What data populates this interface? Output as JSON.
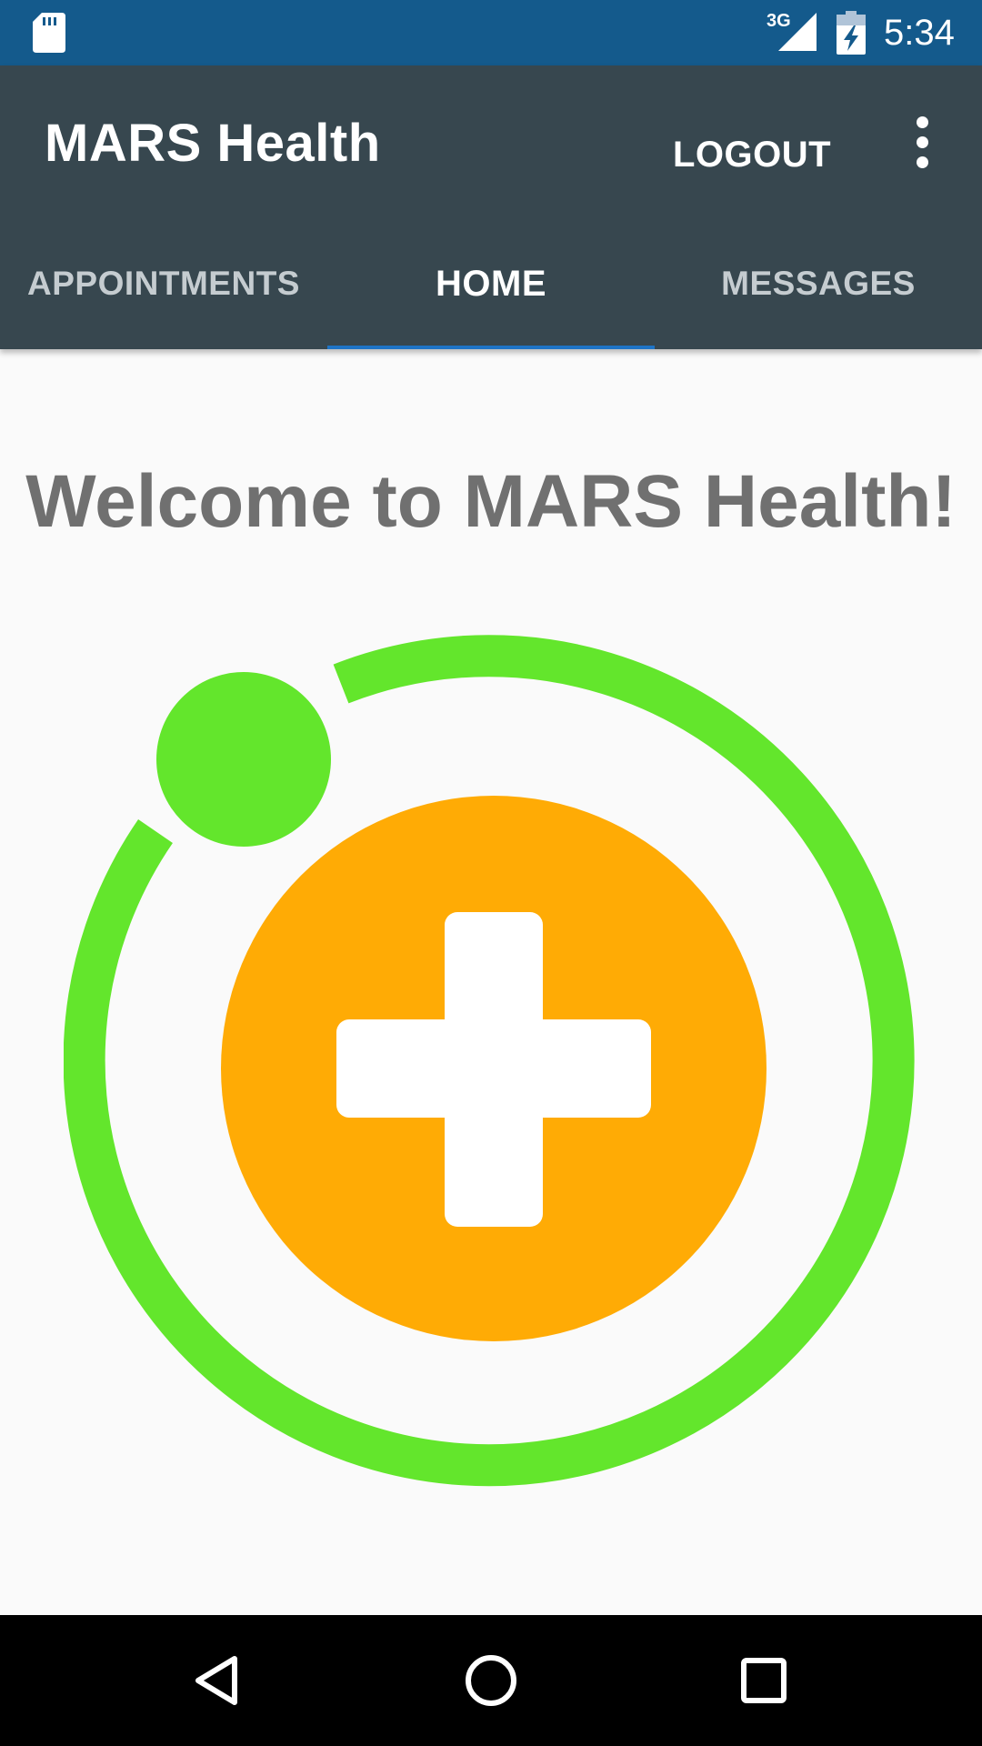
{
  "status_bar": {
    "network": "3G",
    "time": "5:34",
    "icons": [
      "sd-card-icon",
      "signal-icon",
      "battery-charging-icon"
    ],
    "color": "#145a8c"
  },
  "app_bar": {
    "title": "MARS Health",
    "logout_label": "LOGOUT",
    "overflow_icon": "more-vert-icon",
    "color": "#37474f"
  },
  "tabs": [
    {
      "label": "APPOINTMENTS",
      "active": false
    },
    {
      "label": "HOME",
      "active": true
    },
    {
      "label": "MESSAGES",
      "active": false
    }
  ],
  "tab_indicator_color": "#1e74c6",
  "main": {
    "welcome_text": "Welcome to MARS Health!",
    "logo": {
      "icon": "medical-cross-logo",
      "ring_color": "#63e62c",
      "circle_color": "#ffab05",
      "cross_color": "#ffffff"
    }
  },
  "nav_bar": {
    "icons": [
      "back-icon",
      "home-icon",
      "recents-icon"
    ]
  }
}
